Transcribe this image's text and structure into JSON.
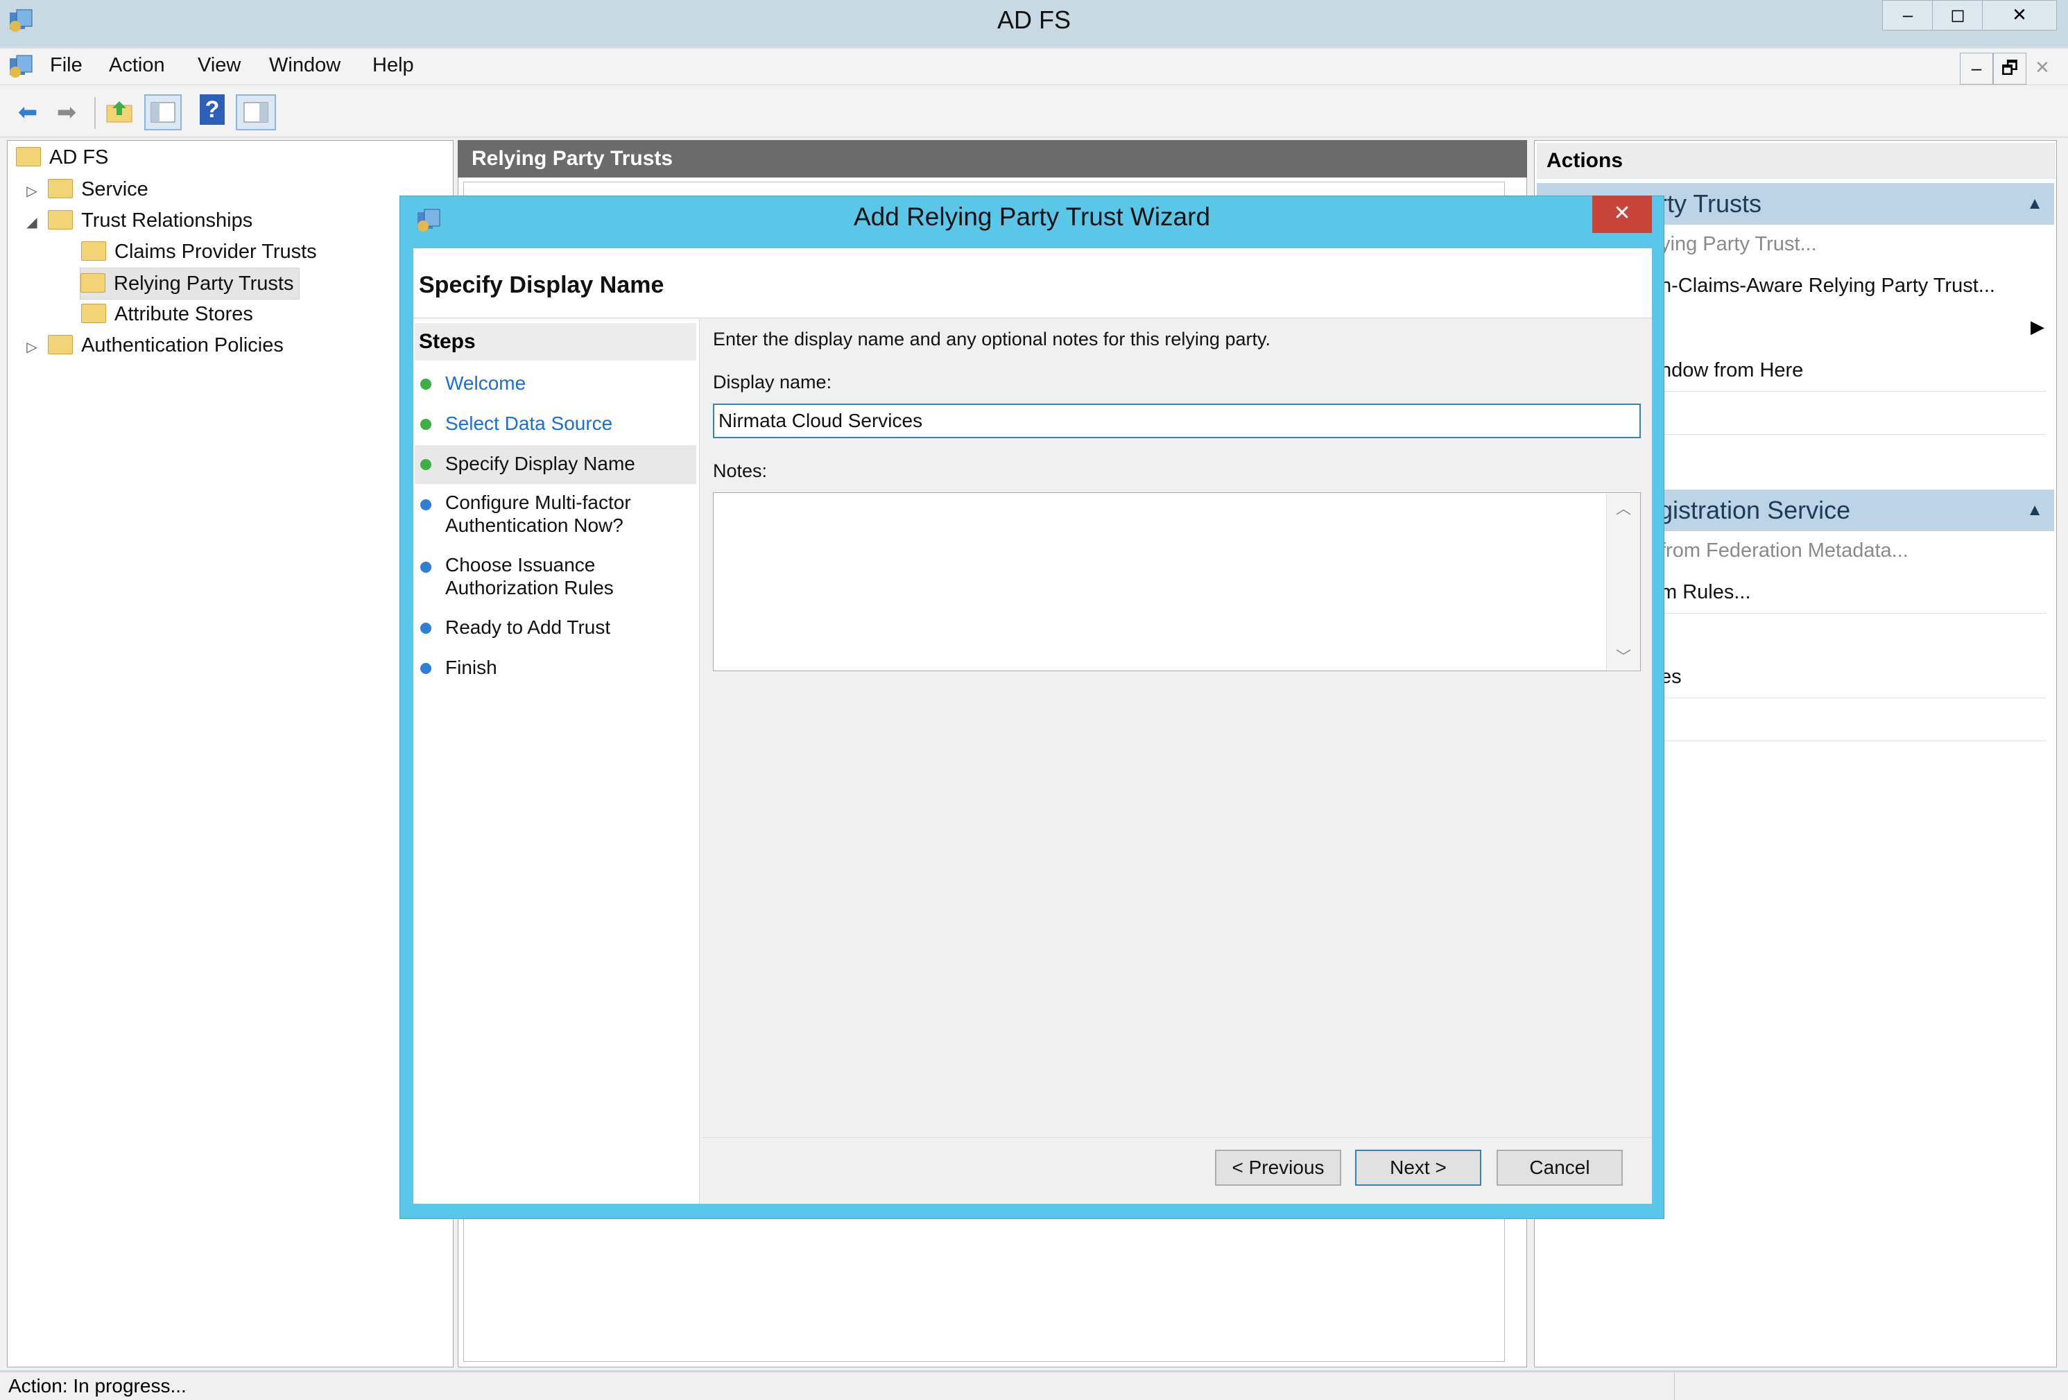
{
  "window": {
    "title": "AD FS",
    "controls": {
      "minimize": "–",
      "maximize": "◻",
      "close": "✕"
    }
  },
  "menubar": {
    "items": [
      "File",
      "Action",
      "View",
      "Window",
      "Help"
    ],
    "mdi_controls": {
      "minimize": "–",
      "restore": "🗗",
      "close": "✕"
    }
  },
  "toolbar": {
    "icons": [
      "back-arrow-icon",
      "forward-arrow-icon",
      "up-folder-icon",
      "show-hide-tree-icon",
      "help-icon",
      "show-hide-action-pane-icon"
    ]
  },
  "tree": {
    "root": "AD FS",
    "items": [
      {
        "label": "Service",
        "level": 1,
        "expander": "▷"
      },
      {
        "label": "Trust Relationships",
        "level": 1,
        "expander": "◢"
      },
      {
        "label": "Claims Provider Trusts",
        "level": 2,
        "expander": ""
      },
      {
        "label": "Relying Party Trusts",
        "level": 2,
        "expander": "",
        "selected": true
      },
      {
        "label": "Attribute Stores",
        "level": 2,
        "expander": ""
      },
      {
        "label": "Authentication Policies",
        "level": 1,
        "expander": "▷"
      }
    ]
  },
  "center": {
    "header": "Relying Party Trusts"
  },
  "actions": {
    "title": "Actions",
    "section1": {
      "title": "rty Trusts",
      "items": [
        "ying Party Trust...",
        "n-Claims-Aware Relying Party Trust...",
        "",
        "ndow from Here",
        ""
      ]
    },
    "section2": {
      "title": "gistration Service",
      "items": [
        "from Federation Metadata...",
        "m Rules...",
        "",
        "es",
        ""
      ]
    }
  },
  "status": {
    "text": "Action:  In progress..."
  },
  "dialog": {
    "title": "Add Relying Party Trust Wizard",
    "close": "✕",
    "heading": "Specify Display Name",
    "steps_title": "Steps",
    "steps": [
      {
        "label": "Welcome",
        "state": "done"
      },
      {
        "label": "Select Data Source",
        "state": "done"
      },
      {
        "label": "Specify Display Name",
        "state": "current"
      },
      {
        "label": "Configure Multi-factor\nAuthentication Now?",
        "state": "pending"
      },
      {
        "label": "Choose Issuance\nAuthorization Rules",
        "state": "pending"
      },
      {
        "label": "Ready to Add Trust",
        "state": "pending"
      },
      {
        "label": "Finish",
        "state": "pending"
      }
    ],
    "instruction": "Enter the display name and any optional notes for this relying party.",
    "display_name_label": "Display name:",
    "display_name_value": "Nirmata Cloud Services",
    "notes_label": "Notes:",
    "notes_value": "",
    "buttons": {
      "previous": "< Previous",
      "next": "Next >",
      "cancel": "Cancel"
    }
  },
  "colors": {
    "dialog_frame": "#5bc7e8",
    "close_red": "#c7443b",
    "step_done": "#3cb043",
    "step_pending": "#2f7fd6",
    "link_blue": "#1a6fd1"
  }
}
